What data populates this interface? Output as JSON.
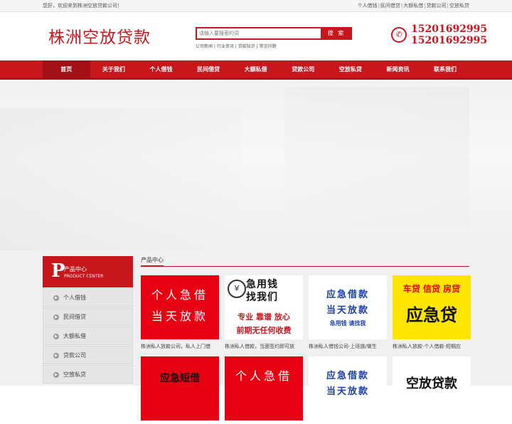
{
  "topbar": {
    "welcome": "您好，欢迎来到株洲空放贷款公司!",
    "links": [
      "个人借钱",
      "民间借贷",
      "大额私借",
      "贷款公司",
      "空放私贷"
    ]
  },
  "header": {
    "logo": "株洲空放贷款",
    "search_placeholder": "请输入要搜索的词",
    "search_button": "搜 索",
    "hot_words": [
      "公司新闻",
      "行业资讯",
      "贷款知识",
      "常见问题"
    ],
    "phones": [
      "15201692995",
      "15201692995"
    ]
  },
  "nav": [
    "首页",
    "关于我们",
    "个人借钱",
    "民间借贷",
    "大额私借",
    "贷款公司",
    "空放私贷",
    "新闻资讯",
    "联系我们"
  ],
  "sidebar": {
    "big_letter": "P",
    "title": "产品中心",
    "subtitle": "PRODUCT CENTER",
    "items": [
      "个人借钱",
      "民间借贷",
      "大额私借",
      "贷款公司",
      "空放私贷"
    ]
  },
  "main": {
    "title": "产品中心",
    "products": [
      {
        "caption": "株洲私人放款公司，私人上门借",
        "lines": [
          "个人急借",
          "当天放款"
        ]
      },
      {
        "caption": "株洲私人借款，当面签约即可放",
        "lines": [
          "急用钱",
          "找我们",
          "专业 靠谱 放心",
          "前期无任何收费"
        ]
      },
      {
        "caption": "株洲私人借钱公司-上班族/做生",
        "lines": [
          "应急借款",
          "当天放款",
          "急用钱 请找我"
        ]
      },
      {
        "caption": "株洲私人放款-个人借款-短期应",
        "lines": [
          "车贷 信贷 房贷",
          "应急贷"
        ]
      },
      {
        "caption": "",
        "lines": [
          "应急短借"
        ]
      },
      {
        "caption": "",
        "lines": [
          "个人急借"
        ]
      },
      {
        "caption": "",
        "lines": [
          "应急借款",
          "当天放款"
        ]
      },
      {
        "caption": "",
        "lines": [
          "空放贷款"
        ]
      }
    ]
  },
  "colors": {
    "brand": "#c8161d",
    "yellow": "#ffe600",
    "blue": "#1a3faa"
  }
}
